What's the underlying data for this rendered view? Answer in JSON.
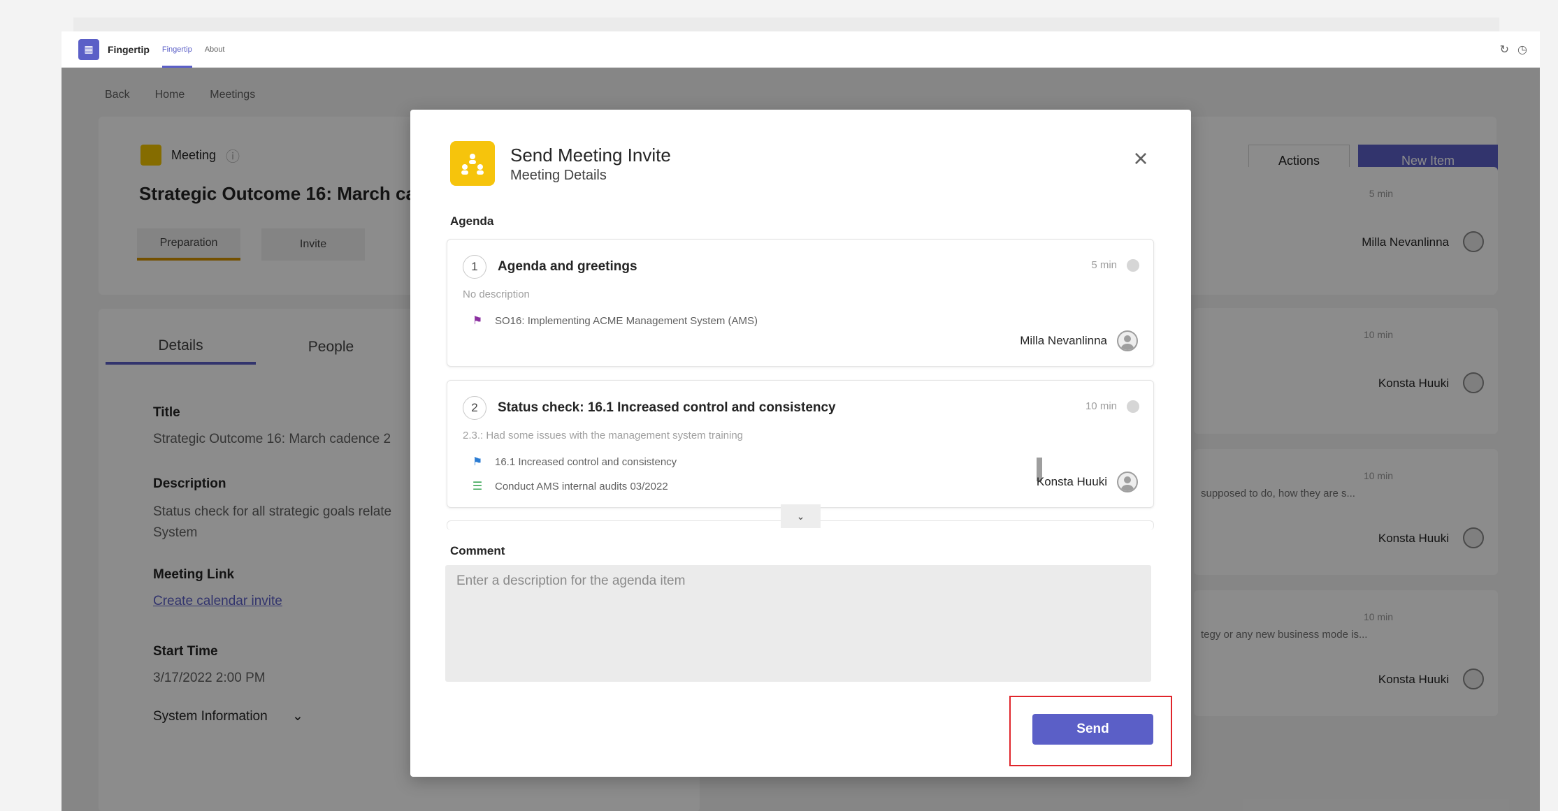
{
  "titlebar": {
    "app_logo": "grid-icon",
    "app_name": "Fingertip",
    "tabs": [
      {
        "label": "Fingertip",
        "active": true
      },
      {
        "label": "About",
        "active": false
      }
    ]
  },
  "breadcrumb": [
    "Back",
    "Home",
    "Meetings"
  ],
  "meeting": {
    "type_label": "Meeting",
    "title": "Strategic Outcome 16: March ca",
    "steps": [
      "Preparation",
      "Invite"
    ],
    "actions_label": "Actions",
    "new_item_label": "New Item"
  },
  "details": {
    "tabs": [
      "Details",
      "People"
    ],
    "title_label": "Title",
    "title_value": "Strategic Outcome 16: March cadence 2",
    "description_label": "Description",
    "description_line1": "Status check for all strategic goals relate",
    "description_line2": "System",
    "meeting_link_label": "Meeting Link",
    "meeting_link_value": "Create calendar invite",
    "start_time_label": "Start Time",
    "start_time_value": "3/17/2022 2:00 PM",
    "system_info_label": "System Information"
  },
  "right_list": [
    {
      "min": "5 min",
      "person": "Milla Nevanlinna",
      "desc": ""
    },
    {
      "min": "10 min",
      "person": "Konsta Huuki",
      "desc": ""
    },
    {
      "min": "10 min",
      "person": "Konsta Huuki",
      "desc": "supposed to do, how they are s..."
    },
    {
      "min": "10 min",
      "person": "Konsta Huuki",
      "desc": "tegy or any new business mode is..."
    }
  ],
  "modal": {
    "title": "Send Meeting Invite",
    "subtitle": "Meeting Details",
    "agenda_label": "Agenda",
    "items": [
      {
        "number": "1",
        "title": "Agenda and greetings",
        "duration": "5 min",
        "description": "No description",
        "links": [
          {
            "icon": "pin-icon",
            "text": "SO16: Implementing ACME Management System (AMS)",
            "color": "#8b2fa0"
          }
        ],
        "person": "Milla Nevanlinna"
      },
      {
        "number": "2",
        "title": "Status check: 16.1 Increased control and consistency",
        "duration": "10 min",
        "description": "2.3.: Had some issues with the management system training",
        "links": [
          {
            "icon": "flag-icon",
            "text": "16.1 Increased control and consistency",
            "color": "#2b7cd3"
          },
          {
            "icon": "task-list-icon",
            "text": "Conduct AMS internal audits 03/2022",
            "color": "#3aa655"
          }
        ],
        "person": "Konsta Huuki"
      }
    ],
    "comment_label": "Comment",
    "comment_placeholder": "Enter a description for the agenda item",
    "comment_value": "",
    "send_label": "Send"
  },
  "colors": {
    "brand": "#5b5fc7",
    "meeting_icon": "#f6c40c",
    "highlight": "#e0252b"
  }
}
